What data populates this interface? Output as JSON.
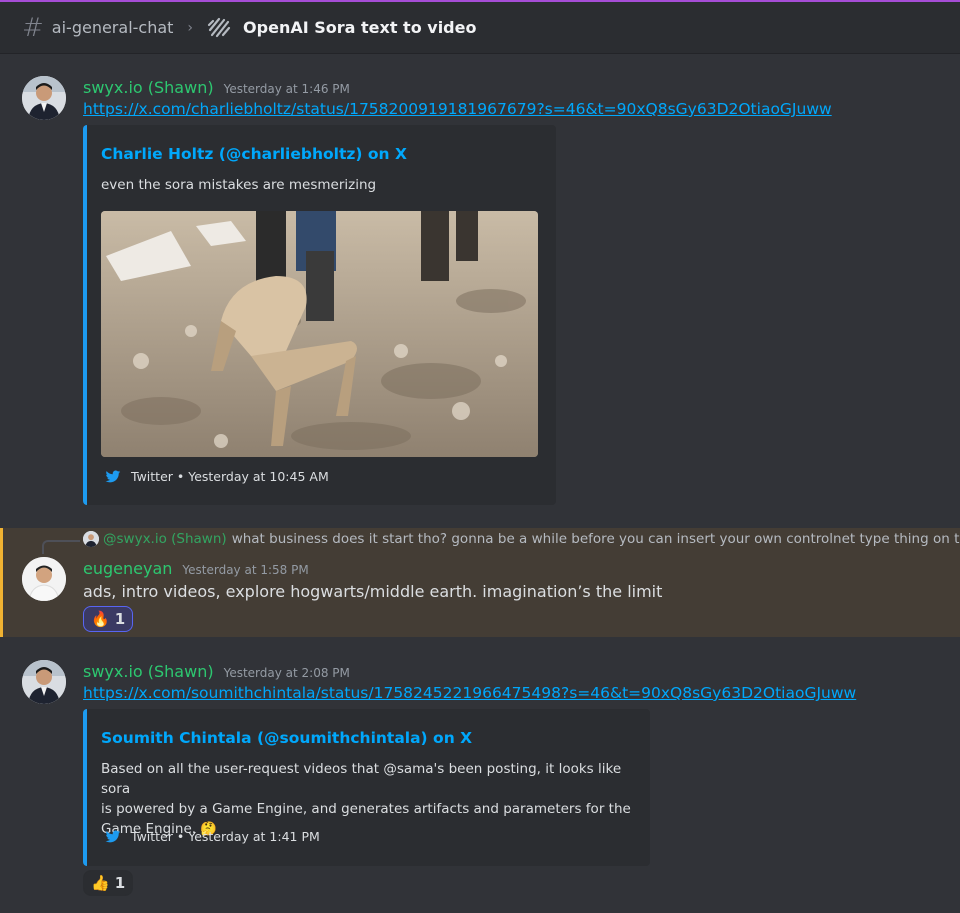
{
  "header": {
    "channel": "ai-general-chat",
    "thread": "OpenAI Sora text to video"
  },
  "messages": [
    {
      "author": "swyx.io (Shawn)",
      "timestamp": "Yesterday at 1:46 PM",
      "link": "https://x.com/charliebholtz/status/1758200919181967679?s=46&t=90xQ8sGy63D2OtiaoGJuww",
      "embed": {
        "title": "Charlie Holtz (@charliebholtz) on X",
        "description": "even the sora mistakes are mesmerizing",
        "footer": "Twitter • Yesterday at 10:45 AM"
      }
    },
    {
      "reply": {
        "author": "@swyx.io (Shawn)",
        "text": "what business does it start tho? gonna be a while before you can insert your own controlnet type thing on this"
      },
      "author": "eugeneyan",
      "timestamp": "Yesterday at 1:58 PM",
      "text": "ads, intro videos, explore hogwarts/middle earth. imagination’s the limit",
      "reaction": {
        "emoji": "🔥",
        "count": "1"
      }
    },
    {
      "author": "swyx.io (Shawn)",
      "timestamp": "Yesterday at 2:08 PM",
      "link": "https://x.com/soumithchintala/status/1758245221966475498?s=46&t=90xQ8sGy63D2OtiaoGJuww",
      "embed": {
        "title": "Soumith Chintala (@soumithchintala) on X",
        "description_lines": [
          "Based on all the user-request videos that @sama's been posting, it looks like sora",
          "is powered by a Game Engine, and generates artifacts and parameters for the",
          "Game Engine. 🤔"
        ],
        "footer": "Twitter • Yesterday at 1:41 PM"
      },
      "reaction": {
        "emoji": "👍",
        "count": "1"
      }
    }
  ]
}
